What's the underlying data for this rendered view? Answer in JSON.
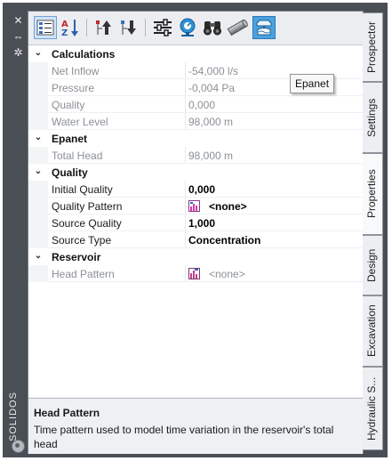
{
  "window": {
    "title": "SOLIDOS"
  },
  "toolbar": {
    "buttons": [
      {
        "name": "categorized",
        "tooltip": ""
      },
      {
        "name": "alphabetical",
        "tooltip": ""
      },
      {
        "name": "expand-up",
        "tooltip": ""
      },
      {
        "name": "collapse-down",
        "tooltip": ""
      },
      {
        "name": "settings",
        "tooltip": ""
      },
      {
        "name": "lookup",
        "tooltip": ""
      },
      {
        "name": "binoculars",
        "tooltip": ""
      },
      {
        "name": "pipe",
        "tooltip": ""
      },
      {
        "name": "epanet",
        "tooltip": "Epanet"
      }
    ]
  },
  "tooltip": {
    "text": "Epanet"
  },
  "grid": {
    "calculations": {
      "label": "Calculations",
      "rows": [
        {
          "name": "Net Inflow",
          "value": "-54,000 l/s"
        },
        {
          "name": "Pressure",
          "value": "-0,004 Pa"
        },
        {
          "name": "Quality",
          "value": "0,000"
        },
        {
          "name": "Water Level",
          "value": "98,000 m"
        }
      ]
    },
    "epanet": {
      "label": "Epanet",
      "rows": [
        {
          "name": "Total Head",
          "value": "98,000 m"
        }
      ]
    },
    "quality": {
      "label": "Quality",
      "rows": [
        {
          "name": "Initial Quality",
          "value": "0,000"
        },
        {
          "name": "Quality Pattern",
          "value": "<none>"
        },
        {
          "name": "Source Quality",
          "value": "1,000"
        },
        {
          "name": "Source Type",
          "value": "Concentration"
        }
      ]
    },
    "reservoir": {
      "label": "Reservoir",
      "rows": [
        {
          "name": "Head Pattern",
          "value": "<none>"
        }
      ]
    }
  },
  "description": {
    "title": "Head Pattern",
    "text": "Time pattern used to model time variation in the reservoir's total head"
  },
  "tabs": [
    {
      "label": "Prospector",
      "active": false
    },
    {
      "label": "Settings",
      "active": false
    },
    {
      "label": "Properties",
      "active": true
    },
    {
      "label": "Design",
      "active": false
    },
    {
      "label": "Excavation",
      "active": false
    },
    {
      "label": "Hydraulic S...",
      "active": false
    }
  ],
  "colors": {
    "accent": "#4aa3df",
    "readonly_text": "#8b9096",
    "frame": "#4a4f56"
  }
}
